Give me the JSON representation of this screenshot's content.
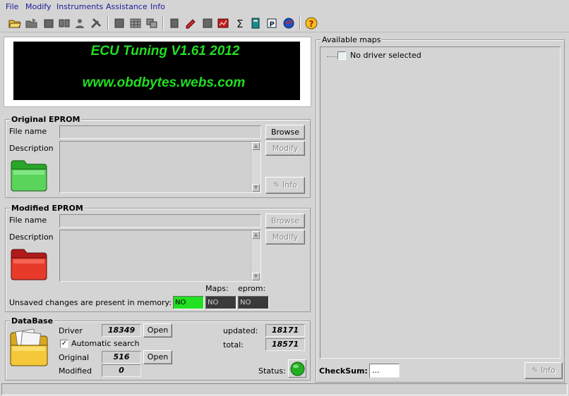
{
  "menu": [
    "File",
    "Modify",
    "Instruments",
    "Assistance",
    "Info"
  ],
  "banner": {
    "title": "ECU Tuning V1.61 2012",
    "url": "www.obdbytes.webs.com"
  },
  "original": {
    "group_title": "Original EPROM",
    "file_label": "File name",
    "desc_label": "Description",
    "browse": "Browse",
    "modify": "Modify",
    "info": "Info"
  },
  "modified": {
    "group_title": "Modified EPROM",
    "file_label": "File name",
    "desc_label": "Description",
    "browse": "Browse",
    "modify": "Modify",
    "unsaved_label": "Unsaved changes are present in memory:",
    "maps_label": "Maps:",
    "eprom_label": "eprom:",
    "indicators": [
      "NO",
      "NO",
      "NO"
    ],
    "indicator_colors": [
      "#22e022",
      "#3a3a3a",
      "#3a3a3a"
    ]
  },
  "database": {
    "group_title": "DataBase",
    "driver_label": "Driver",
    "driver_value": "18349",
    "open_label": "Open",
    "auto_search_label": "Automatic search",
    "auto_search_checked": true,
    "original_label": "Original",
    "original_value": "516",
    "modified_label": "Modified",
    "modified_value": "0",
    "updated_label": "updated:",
    "updated_value": "18171",
    "total_label": "total:",
    "total_value": "18571",
    "status_label": "Status:",
    "status_color": "#22b022"
  },
  "maps": {
    "group_title": "Available maps",
    "tree_item": "No driver selected"
  },
  "checksum": {
    "label": "CheckSum:",
    "value": "...",
    "info": "Info"
  },
  "colors": {
    "banner_bg": "#000000",
    "banner_title": "#22dd22",
    "banner_url": "#22dd22",
    "panel_bg": "#d4d4d4"
  }
}
